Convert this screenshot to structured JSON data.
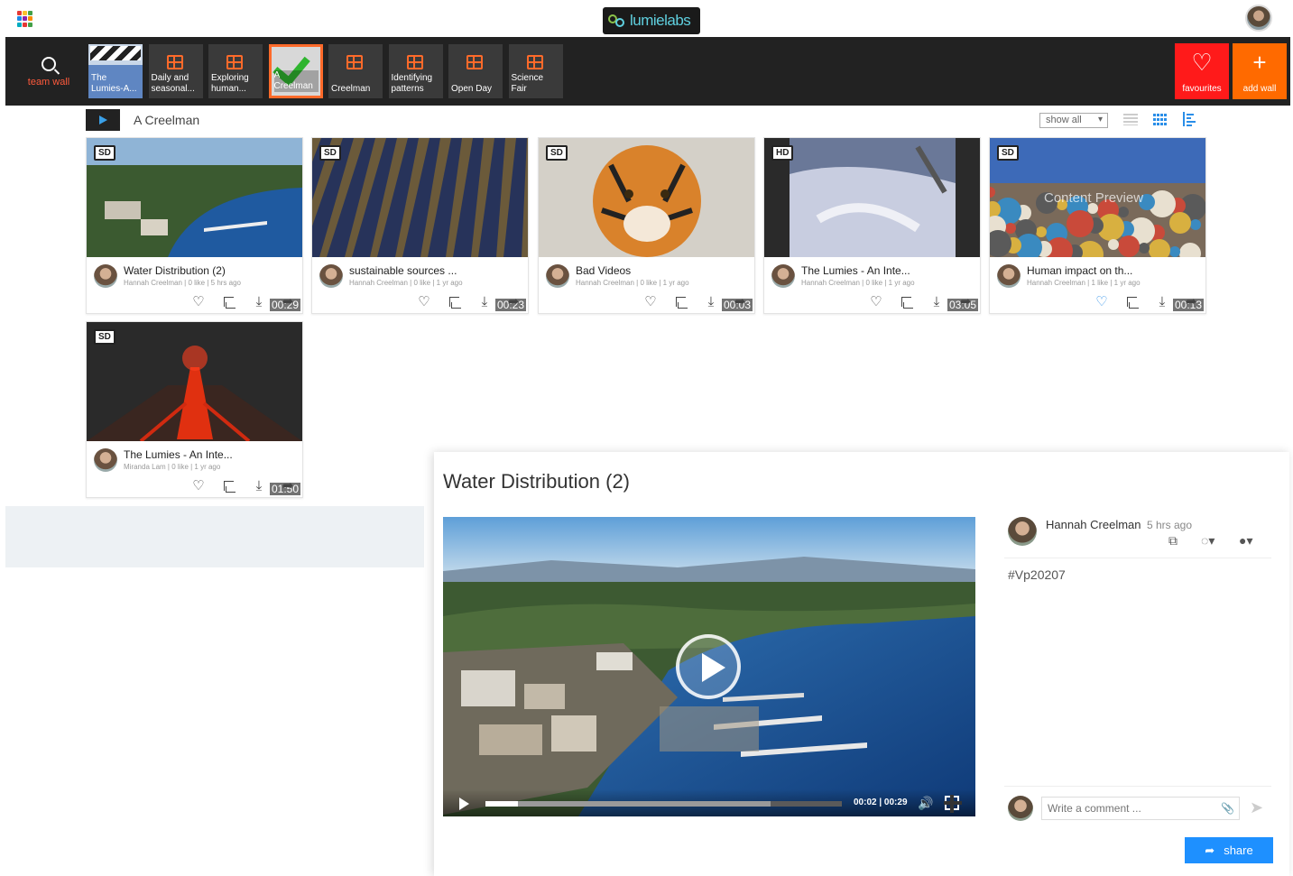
{
  "header": {
    "logo_text": "lumielabs",
    "apps_colors": [
      "#e53935",
      "#fbc02d",
      "#43a047",
      "#1e88e5",
      "#8e24aa",
      "#fb8c00",
      "#00acc1",
      "#e53935",
      "#43a047"
    ]
  },
  "nav": {
    "search_label": "team wall",
    "walls": [
      {
        "label": "The Lumies-A...",
        "style": "thumb"
      },
      {
        "label": "Daily and seasonal...",
        "style": "icon"
      },
      {
        "label": "Exploring human...",
        "style": "icon"
      },
      {
        "label": "A Creelman",
        "style": "active"
      },
      {
        "label": "Creelman",
        "style": "icon"
      },
      {
        "label": "Identifying patterns",
        "style": "icon"
      },
      {
        "label": "Open Day",
        "style": "icon"
      },
      {
        "label": "Science Fair",
        "style": "icon"
      }
    ],
    "favourites_label": "favourites",
    "add_wall_label": "add wall",
    "favourites_color": "#ff1a1a",
    "add_wall_color": "#ff6a00"
  },
  "toolbar": {
    "wall_title": "A Creelman",
    "filter_value": "show all"
  },
  "cards": [
    {
      "quality": "SD",
      "duration": "00:29",
      "title": "Water Distribution (2)",
      "meta": "Hannah Creelman | 0 like | 5 hrs ago",
      "liked": false,
      "thumb": "lake"
    },
    {
      "quality": "SD",
      "duration": "00:23",
      "title": "sustainable sources ...",
      "meta": "Hannah Creelman | 0 like | 1 yr ago",
      "liked": false,
      "thumb": "solar"
    },
    {
      "quality": "SD",
      "duration": "00:03",
      "title": "Bad Videos",
      "meta": "Hannah Creelman | 0 like | 1 yr ago",
      "liked": false,
      "thumb": "tiger"
    },
    {
      "quality": "HD",
      "duration": "03:05",
      "title": "The Lumies - An Inte...",
      "meta": "Hannah Creelman | 0 like | 1 yr ago",
      "liked": false,
      "thumb": "storm"
    },
    {
      "quality": "SD",
      "duration": "00:13",
      "title": "Human impact on th...",
      "meta": "Hannah Creelman | 1 like | 1 yr ago",
      "liked": true,
      "thumb": "trash",
      "overlay": "Content Preview"
    },
    {
      "quality": "SD",
      "duration": "01:50",
      "title": "The Lumies - An Inte...",
      "meta": "Miranda Lam | 0 like | 1 yr ago",
      "liked": false,
      "thumb": "volcano"
    }
  ],
  "detail": {
    "title": "Water Distribution (2)",
    "author": "Hannah Creelman",
    "posted": "5 hrs ago",
    "hashtag": "#Vp20207",
    "time_display": "00:02 | 00:29",
    "progress_fraction": 0.09,
    "buffered_fraction": 0.8,
    "comment_placeholder": "Write a comment ...",
    "share_label": "share"
  }
}
